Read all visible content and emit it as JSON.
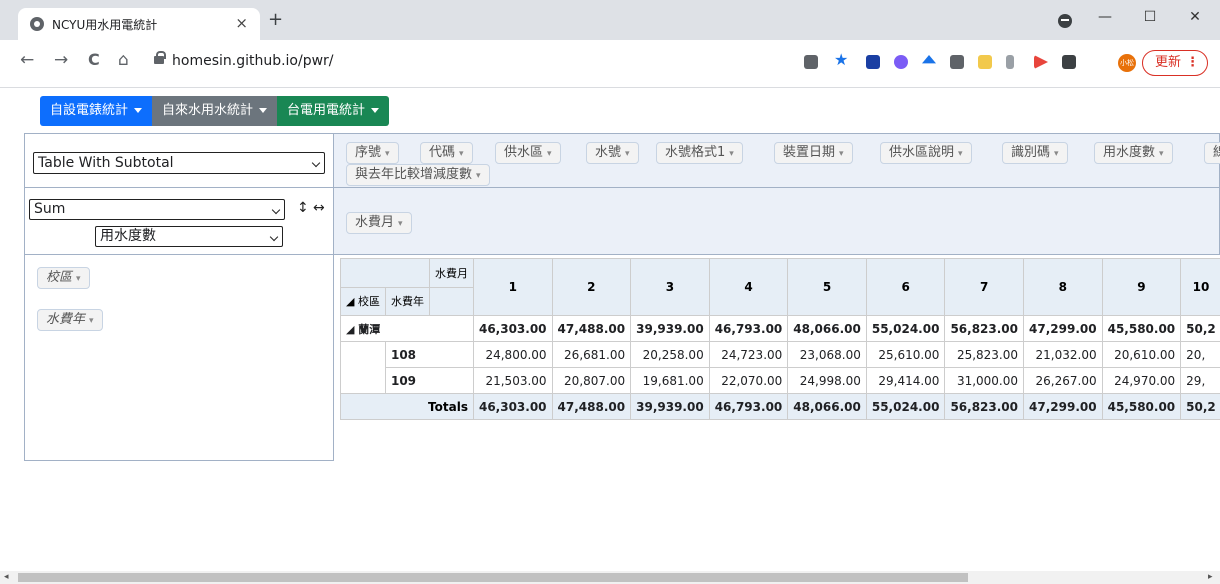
{
  "browser": {
    "tab_title": "NCYU用水用電統計",
    "tab_close": "×",
    "new_tab": "+",
    "url": "homesin.github.io/pwr/",
    "avatar_text": "小松",
    "update_label": "更新",
    "update_more": "⋮",
    "nav": {
      "back": "←",
      "forward": "→",
      "reload": "C",
      "home": "⌂"
    },
    "window": {
      "minimize": "—",
      "maximize": "☐",
      "close": "✕"
    }
  },
  "menu": [
    {
      "label": "自設電錶統計",
      "color": "#0d6efd"
    },
    {
      "label": "自來水用水統計",
      "color": "#6c757d"
    },
    {
      "label": "台電用電統計",
      "color": "#198754"
    }
  ],
  "pivot": {
    "renderer": "Table With Subtotal",
    "aggregator": "Sum",
    "aggregator_attr": "用水度數",
    "sort_row": "↕",
    "sort_col": "↔",
    "unused_fields": [
      "序號",
      "代碼",
      "供水區",
      "水號",
      "水號格式1",
      "裝置日期",
      "供水區說明",
      "識別碼",
      "用水度數",
      "線",
      "與去年比較增減度數"
    ],
    "col_fields": [
      "水費月"
    ],
    "row_fields": [
      "校區",
      "水費年"
    ],
    "pill_caret": "▾"
  },
  "table": {
    "col_attr_label": "水費月",
    "row_attr_1": "◢ 校區",
    "row_attr_2": "水費年",
    "columns": [
      "1",
      "2",
      "3",
      "4",
      "5",
      "6",
      "7",
      "8",
      "9",
      "10"
    ],
    "group": {
      "label": "◢ 蘭潭",
      "values": [
        "46,303.00",
        "47,488.00",
        "39,939.00",
        "46,793.00",
        "48,066.00",
        "55,024.00",
        "56,823.00",
        "47,299.00",
        "45,580.00",
        "50,2"
      ]
    },
    "rows": [
      {
        "year": "108",
        "values": [
          "24,800.00",
          "26,681.00",
          "20,258.00",
          "24,723.00",
          "23,068.00",
          "25,610.00",
          "25,823.00",
          "21,032.00",
          "20,610.00",
          "20,"
        ]
      },
      {
        "year": "109",
        "values": [
          "21,503.00",
          "20,807.00",
          "19,681.00",
          "22,070.00",
          "24,998.00",
          "29,414.00",
          "31,000.00",
          "26,267.00",
          "24,970.00",
          "29,"
        ]
      }
    ],
    "totals_label": "Totals",
    "totals": [
      "46,303.00",
      "47,488.00",
      "39,939.00",
      "46,793.00",
      "48,066.00",
      "55,024.00",
      "56,823.00",
      "47,299.00",
      "45,580.00",
      "50,2"
    ]
  },
  "scrollbar": {
    "left_arrow": "◂",
    "right_arrow": "▸"
  }
}
